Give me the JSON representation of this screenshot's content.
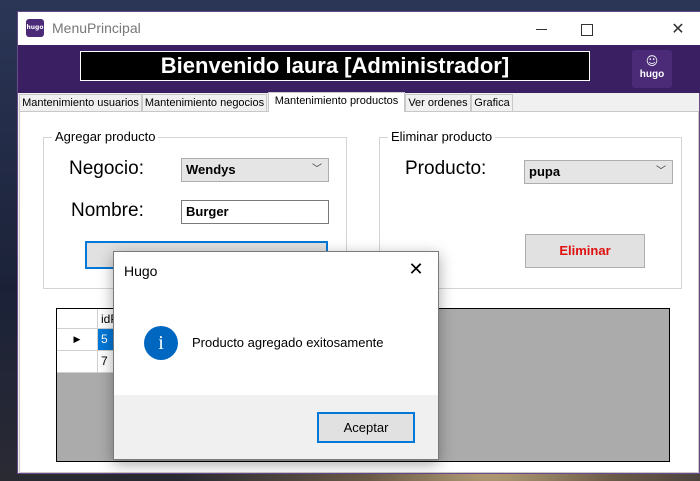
{
  "window": {
    "title": "MenuPrincipal",
    "icon_text": "hugo",
    "controls": [
      "minimize-icon",
      "maximize-icon",
      "close-icon"
    ]
  },
  "header": {
    "welcome": "Bienvenido laura [Administrador]",
    "logo_text": "hugo"
  },
  "tabs": [
    {
      "label": "Mantenimiento usuarios"
    },
    {
      "label": "Mantenimiento negocios"
    },
    {
      "label": "Mantenimiento productos",
      "active": true
    },
    {
      "label": "Ver ordenes"
    },
    {
      "label": "Grafica"
    }
  ],
  "add_product": {
    "legend": "Agregar producto",
    "negocio_label": "Negocio:",
    "negocio_value": "Wendys",
    "nombre_label": "Nombre:",
    "nombre_value": "Burger"
  },
  "delete_product": {
    "legend": "Eliminar producto",
    "producto_label": "Producto:",
    "producto_value": "pupa",
    "delete_button": "Eliminar"
  },
  "grid": {
    "column_header_partial": "idP",
    "rows": [
      {
        "id": "5",
        "selected": true
      },
      {
        "id": "7",
        "selected": false
      }
    ]
  },
  "dialog": {
    "title": "Hugo",
    "message": "Producto agregado exitosamente",
    "ok_button": "Aceptar",
    "icon": "info-icon"
  },
  "colors": {
    "header_bg": "#3a1f63",
    "accent": "#0078d7",
    "delete_text": "#e01010"
  }
}
